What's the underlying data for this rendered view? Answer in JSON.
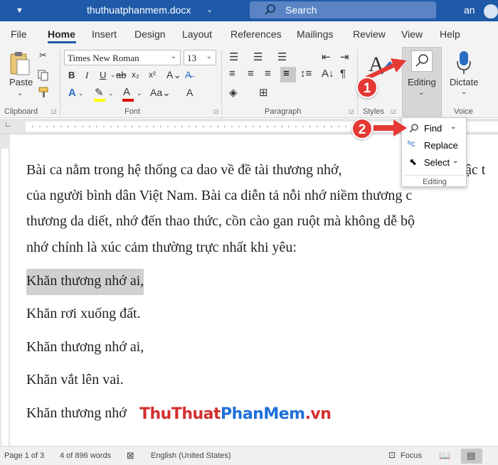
{
  "titlebar": {
    "doc_title": "thuthuatphanmem.docx",
    "search_placeholder": "Search",
    "user": "an"
  },
  "tabs": [
    "File",
    "Home",
    "Insert",
    "Design",
    "Layout",
    "References",
    "Mailings",
    "Review",
    "View",
    "Help"
  ],
  "active_tab": "Home",
  "ribbon": {
    "clipboard": {
      "paste_label": "Paste",
      "group_label": "Clipboard"
    },
    "font": {
      "font_name": "Times New Roman",
      "font_size": "13",
      "group_label": "Font"
    },
    "paragraph": {
      "group_label": "Paragraph"
    },
    "styles": {
      "group_label": "Styles"
    },
    "editing": {
      "label": "Editing"
    },
    "voice": {
      "dictate_label": "Dictate",
      "group_label": "Voice"
    }
  },
  "editing_menu": {
    "find": "Find",
    "replace": "Replace",
    "select": "Select",
    "title": "Editing"
  },
  "document": {
    "intro_lines": [
      "Bài ca nằm trong hệ thống ca dao về đề tài thương nhớ,",
      "của người bình dân Việt Nam. Bài ca diễn tả nỗi nhớ niềm thương c",
      "thương da diết, nhớ đến thao thức, cồn cào gan ruột mà không dễ bộ",
      "nhớ chính là xúc cảm thường trực nhất khi yêu:"
    ],
    "intro_tail": "bậc t",
    "verses": [
      "Khăn thương nhớ ai,",
      "Khăn rơi xuống đất.",
      "Khăn thương nhớ ai,",
      "Khăn vắt lên vai.",
      "Khăn thương nhớ"
    ]
  },
  "statusbar": {
    "page": "Page 1 of 3",
    "words": "4 of 896 words",
    "language": "English (United States)",
    "focus": "Focus"
  },
  "annotations": {
    "badge1": "1",
    "badge2": "2"
  },
  "watermark": {
    "part1": "ThuThuat",
    "part2": "PhanMem",
    "part3": ".vn"
  },
  "colors": {
    "titlebar": "#1f5aa9",
    "badge": "#e53935",
    "highlight": "#d0d0d0"
  }
}
